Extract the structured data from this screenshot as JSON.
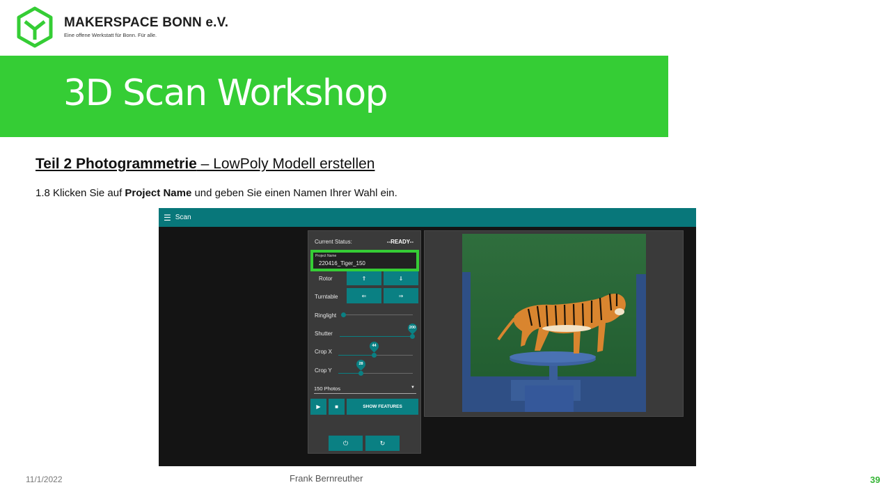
{
  "brand": {
    "name": "MAKERSPACE BONN e.V.",
    "tagline": "Eine offene Werkstatt für Bonn. Für alle."
  },
  "slide": {
    "title": "3D Scan Workshop",
    "subtitle_part": "Teil 2  Photogrammetrie",
    "subtitle_rest": " – LowPoly Modell erstellen",
    "instruction_pre": "1.8 Klicken Sie auf ",
    "instruction_bold": "Project Name",
    "instruction_post": " und geben Sie einen Namen Ihrer Wahl ein."
  },
  "app": {
    "title": "Scan",
    "status_label": "Current Status:",
    "status_value": "--READY--",
    "project_name_label": "Project Name",
    "project_name_value": "220416_Tiger_150",
    "rotor_label": "Rotor",
    "rotor_up": "⇑",
    "rotor_down": "⇓",
    "turntable_label": "Turntable",
    "turntable_left": "⇐",
    "turntable_right": "⇒",
    "ringlight_label": "Ringlight",
    "ringlight_value": 0,
    "shutter_label": "Shutter",
    "shutter_value": "200",
    "cropx_label": "Crop X",
    "cropx_value": "44",
    "cropy_label": "Crop Y",
    "cropy_value": "28",
    "photos_value": "150 Photos",
    "play_icon": "▶",
    "stop_icon": "■",
    "show_features_label": "SHOW FEATURES",
    "power_icon": "⏻",
    "refresh_icon": "↻"
  },
  "footer": {
    "date": "11/1/2022",
    "author": "Frank Bernreuther",
    "page": "39"
  },
  "colors": {
    "accent_green": "#35cd35",
    "app_teal": "#08777a"
  }
}
